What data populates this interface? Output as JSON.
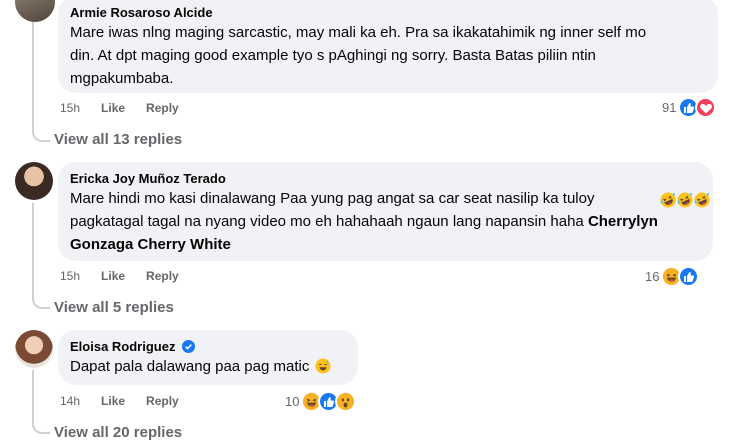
{
  "comments": [
    {
      "author": "Armie Rosaroso Alcide",
      "lines": [
        "Mare iwas nlng maging sarcastic, may mali ka eh. Pra sa ikakatahimik ng inner self mo",
        "din. At dpt maging good example tyo s pAghingi ng sorry. Basta Batas piliin ntin",
        "mgpakumbaba."
      ],
      "time": "15h",
      "like_label": "Like",
      "reply_label": "Reply",
      "reaction_count": "91",
      "reaction_icons": [
        "like-icon",
        "love-icon"
      ],
      "view_replies": "View all 13 replies"
    },
    {
      "author": "Ericka Joy Muñoz Terado",
      "line1": "Mare hindi mo kasi dinalawang Paa yung pag angat sa car seat nasilip ka tuloy",
      "line2": "pagkatagal tagal na nyang video mo eh hahahaah ngaun lang napansin haha",
      "mention1": "Cherrylyn",
      "mention2_line3": "Gonzaga",
      "mention3": "Cherry White",
      "emojis": [
        "rofl-emoji",
        "rofl-emoji",
        "rofl-emoji"
      ],
      "time": "15h",
      "like_label": "Like",
      "reply_label": "Reply",
      "reaction_count": "16",
      "reaction_icons": [
        "haha-icon",
        "like-icon"
      ],
      "view_replies": "View all 5 replies"
    },
    {
      "author": "Eloisa Rodriguez",
      "verified_icon": "verified-badge-icon",
      "text": "Dapat pala dalawang paa pag matic",
      "emoji": "sweat-smile-emoji",
      "time": "14h",
      "like_label": "Like",
      "reply_label": "Reply",
      "reaction_count": "10",
      "reaction_icons": [
        "haha-icon",
        "like-icon",
        "wow-icon"
      ],
      "view_replies": "View all 20 replies"
    }
  ],
  "colors": {
    "bubble": "#f0f2f5",
    "secondary_text": "#65676b",
    "like_blue": "#1877f2",
    "love_red": "#f33e58",
    "haha_yellow": "#f7b125"
  }
}
